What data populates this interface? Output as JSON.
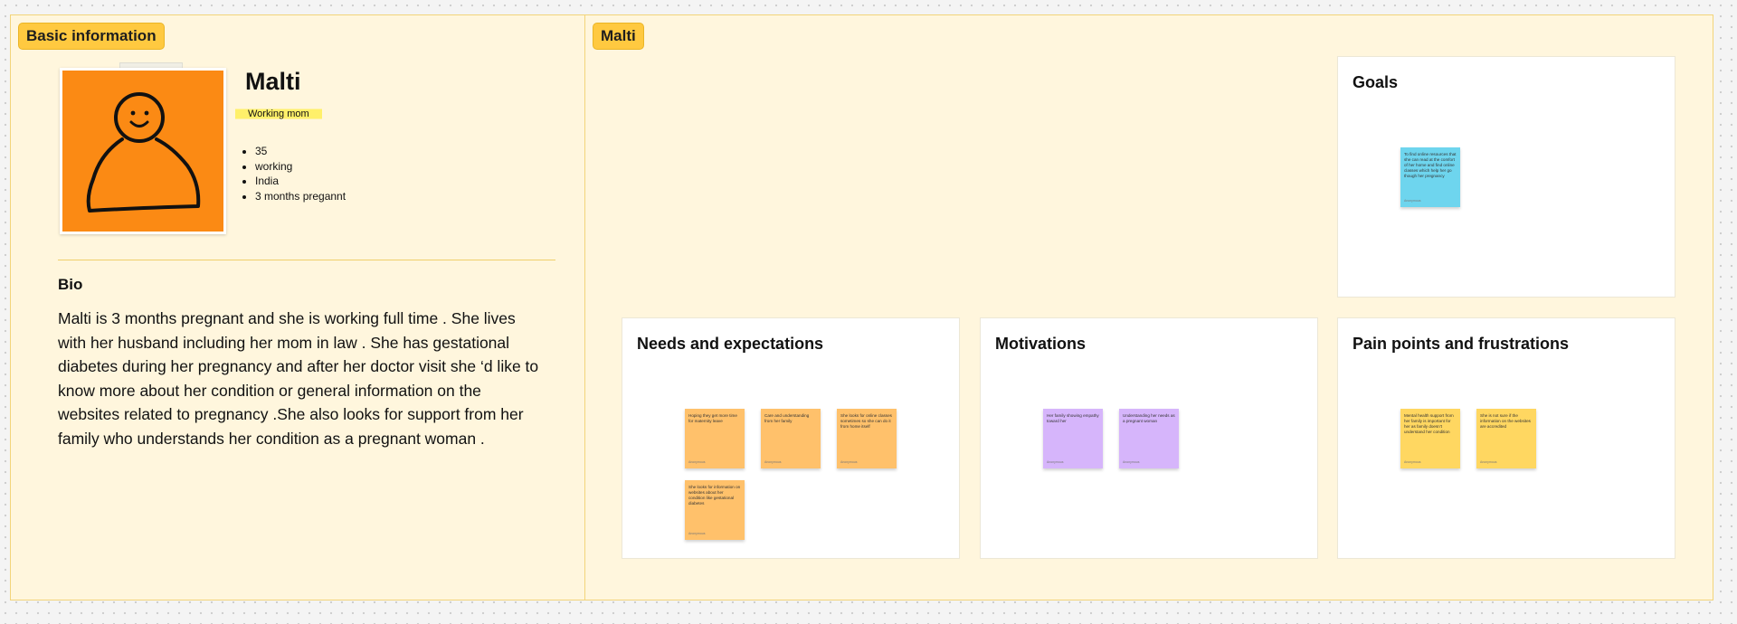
{
  "basic": {
    "label": "Basic information",
    "name": "Malti",
    "tag": "Working mom",
    "facts": [
      "35",
      "working",
      "India",
      "3 months pregannt"
    ],
    "bio_title": "Bio",
    "bio_text": "Malti is 3 months pregnant and she is working full time . She lives with her husband including her mom in law . She has gestational diabetes during her pregnancy and after her doctor visit she ‘d like to know more about her condition or general information on the websites related to pregnancy .She also looks for support from her family who understands her condition as a pregnant woman ."
  },
  "persona": {
    "label": "Malti",
    "goals": {
      "title": "Goals",
      "notes": [
        {
          "text": "To find online resources that she can read at the comfort of her home and find online classes which help her go though her pregnancy",
          "author": "Anonymous",
          "color": "#6ed5ee"
        }
      ]
    },
    "needs": {
      "title": "Needs and expectations",
      "notes": [
        {
          "text": "Hoping they get more time for maternity leave",
          "author": "Anonymous",
          "color": "#ffc16b"
        },
        {
          "text": "Care and understanding from her family",
          "author": "Anonymous",
          "color": "#ffc16b"
        },
        {
          "text": "She looks for online classes sometimes so she can do it from home itself",
          "author": "Anonymous",
          "color": "#ffc16b"
        },
        {
          "text": "She looks for information on websites about her condition like gestational diabetes",
          "author": "Anonymous",
          "color": "#ffc16b"
        }
      ]
    },
    "motivations": {
      "title": "Motivations",
      "notes": [
        {
          "text": "Her family showing empathy toward her",
          "author": "Anonymous",
          "color": "#d6b5fb"
        },
        {
          "text": "Understanding her needs as a pregnant woman",
          "author": "Anonymous",
          "color": "#d6b5fb"
        }
      ]
    },
    "pains": {
      "title": "Pain points and frustrations",
      "notes": [
        {
          "text": "Mental health support from her family is important for her as family doesn't understand her condition",
          "author": "Anonymous",
          "color": "#ffd761"
        },
        {
          "text": "She is not sure if the information on the websites are accredited",
          "author": "Anonymous",
          "color": "#ffd761"
        }
      ]
    }
  }
}
